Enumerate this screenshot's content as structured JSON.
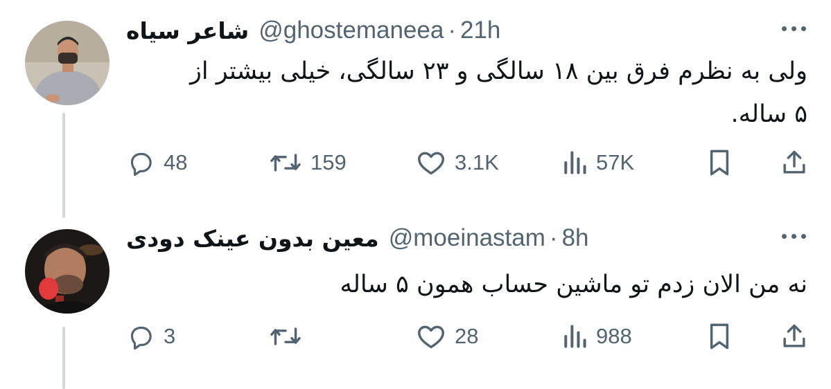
{
  "tweets": [
    {
      "display_name": "شاعر سیاه",
      "handle": "@ghostemaneea",
      "separator": "·",
      "time": "21h",
      "text_lines": [
        "ولی به نظرم فرق بین ۱۸ سالگی و ۲۳ سالگی، خیلی بیشتر از",
        "۵ ساله."
      ],
      "counts": {
        "replies": "48",
        "retweets": "159",
        "likes": "3.1K",
        "views": "57K"
      }
    },
    {
      "display_name": "معین بدون عینک دودی",
      "handle": "@moeinastam",
      "separator": "·",
      "time": "8h",
      "text_lines": [
        "نه من الان زدم تو ماشین حساب همون ۵ ساله"
      ],
      "counts": {
        "replies": "3",
        "retweets": "",
        "likes": "28",
        "views": "988"
      }
    }
  ],
  "icons": {
    "reply": "reply-bubble-icon",
    "retweet": "retweet-icon",
    "like": "heart-icon",
    "views": "views-bar-chart-icon",
    "bookmark": "bookmark-icon",
    "share": "share-upload-icon",
    "more": "more-dots-icon"
  },
  "colors": {
    "text_primary": "#0f1419",
    "text_secondary": "#536471",
    "thread_line": "#cfd9de",
    "background": "#ffffff"
  }
}
